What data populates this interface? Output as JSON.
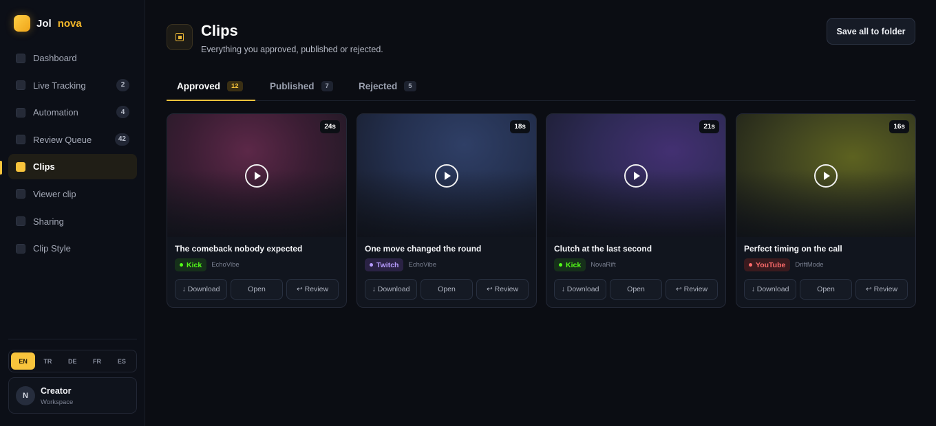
{
  "brand": {
    "name": "Jol",
    "accent": "nova"
  },
  "sidebar": {
    "items": [
      {
        "label": "Dashboard",
        "count": ""
      },
      {
        "label": "Live Tracking",
        "count": "2"
      },
      {
        "label": "Automation",
        "count": "4"
      },
      {
        "label": "Review Queue",
        "count": "42"
      },
      {
        "label": "Clips",
        "count": "",
        "active": true
      },
      {
        "label": "Viewer clip",
        "count": ""
      },
      {
        "label": "Sharing",
        "count": ""
      },
      {
        "label": "Clip Style",
        "count": ""
      }
    ],
    "languages": [
      "EN",
      "TR",
      "DE",
      "FR",
      "ES"
    ],
    "active_language": "EN",
    "profile": {
      "initial": "N",
      "name": "Creator",
      "role": "Workspace"
    }
  },
  "header": {
    "icon": "clips-icon",
    "title": "Clips",
    "subtitle": "Everything you approved, published or rejected.",
    "save_label": "Save all to folder"
  },
  "tabs": [
    {
      "label": "Approved",
      "count": "12",
      "active": true
    },
    {
      "label": "Published",
      "count": "7"
    },
    {
      "label": "Rejected",
      "count": "5"
    }
  ],
  "clips": [
    {
      "title": "The comeback nobody expected",
      "duration": "24s",
      "platform": "Kick",
      "channel": "EchoVibe"
    },
    {
      "title": "One move changed the round",
      "duration": "18s",
      "platform": "Twitch",
      "channel": "EchoVibe"
    },
    {
      "title": "Clutch at the last second",
      "duration": "21s",
      "platform": "Kick",
      "channel": "NovaRift"
    },
    {
      "title": "Perfect timing on the call",
      "duration": "16s",
      "platform": "YouTube",
      "channel": "DriftMode"
    }
  ],
  "card_actions": {
    "download": "↓ Download",
    "open": "Open",
    "review": "↩ Review"
  },
  "colors": {
    "accent": "#f8c43c",
    "kick": "#53fc18",
    "twitch": "#b79cff",
    "youtube": "#ff6b6b"
  }
}
